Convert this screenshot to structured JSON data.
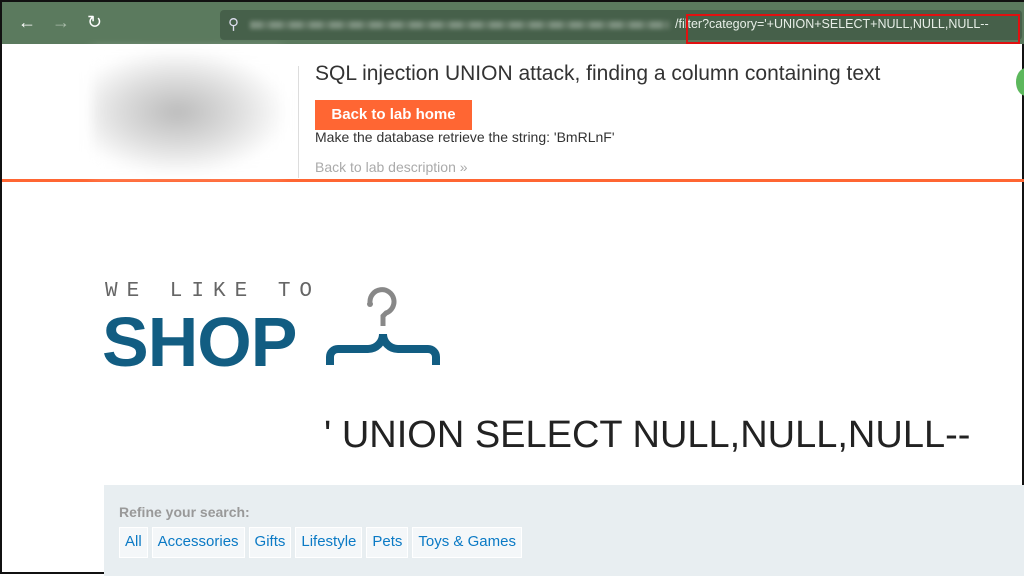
{
  "browser": {
    "url_visible": "/filter?category='+UNION+SELECT+NULL,NULL,NULL--",
    "back_icon": "arrow-left",
    "forward_icon": "arrow-right",
    "reload_icon": "reload",
    "search_icon": "magnifier"
  },
  "lab_header": {
    "title": "SQL injection UNION attack, finding a column containing text",
    "back_home": "Back to lab home",
    "hint": "Make the database retrieve the string: 'BmRLnF'",
    "back_description": "Back to lab description"
  },
  "shop": {
    "tagline": "WE LIKE TO",
    "name": "SHOP",
    "query_heading": "' UNION SELECT NULL,NULL,NULL--"
  },
  "filter": {
    "label": "Refine your search:",
    "categories": [
      "All",
      "Accessories",
      "Gifts",
      "Lifestyle",
      "Pets",
      "Toys & Games"
    ]
  },
  "colors": {
    "accent": "#ff6633",
    "brand": "#125d82",
    "toolbar": "#5b7a5e",
    "link": "#0b7ac5",
    "highlight": "#e01010"
  }
}
